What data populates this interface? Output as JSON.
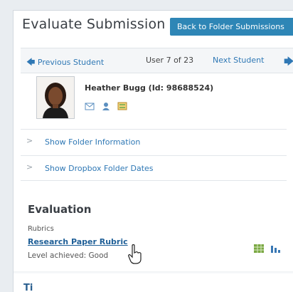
{
  "header": {
    "title": "Evaluate Submission",
    "back_button": "Back to Folder Submissions"
  },
  "navigation": {
    "previous_label": "Previous Student",
    "counter": "User 7 of 23",
    "next_label": "Next Student"
  },
  "student": {
    "name": "Heather Bugg (Id: 98688524)",
    "icons": [
      "email-icon",
      "user-icon",
      "grades-icon"
    ]
  },
  "sections": [
    {
      "label": "Show Folder Information"
    },
    {
      "label": "Show Dropbox Folder Dates"
    }
  ],
  "evaluation": {
    "heading": "Evaluation",
    "rubrics_label": "Rubrics",
    "rubric_name": "Research Paper Rubric",
    "level_achieved": "Level achieved: Good"
  },
  "footer_text": "Ti",
  "colors": {
    "accent": "#2e86b6",
    "link": "#2f78b5"
  }
}
